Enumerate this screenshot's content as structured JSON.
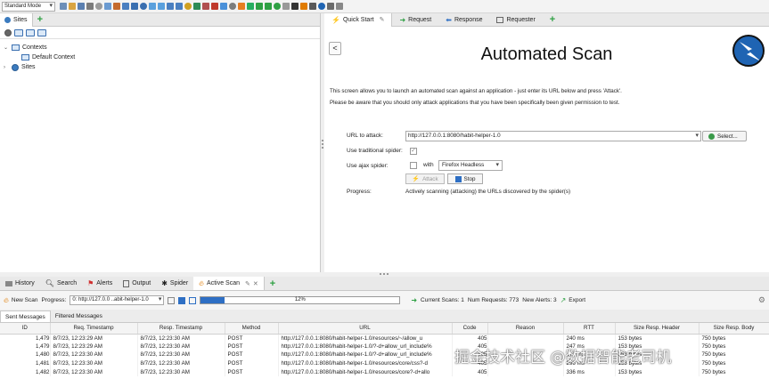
{
  "toolbar": {
    "mode": "Standard Mode",
    "icons": [
      "new-session-icon",
      "open-session-icon",
      "persist-session-icon",
      "snapshot-icon",
      "properties-icon",
      "options-icon",
      "check-updates-icon",
      "layout-left-icon",
      "layout-full-icon",
      "layout-tabs-icon",
      "show-tabs-icon",
      "hide-tabs-icon",
      "expand-sites-icon",
      "expand-info-icon",
      "break-icon",
      "scope-icon",
      "tags-icon",
      "marketplace-icon",
      "manage-add-ons-icon",
      "scripts-icon",
      "bug-icon",
      "hud-icon",
      "breakpoint-icon",
      "step-icon",
      "continue-icon",
      "drop-icon",
      "console-icon",
      "attack-mode-icon",
      "spider-icon",
      "ajax-spider-icon",
      "encode-icon",
      "fuzz-icon"
    ]
  },
  "left_panel": {
    "tab_label": "Sites",
    "tree": {
      "contexts_label": "Contexts",
      "default_context_label": "Default Context",
      "sites_label": "Sites"
    }
  },
  "right_panel": {
    "tabs": [
      "Quick Start",
      "Request",
      "Response",
      "Requester"
    ],
    "title": "Automated Scan",
    "intro_line1": "This screen allows you to launch an automated scan against  an application - just enter its URL below and press 'Attack'.",
    "intro_line2": "Please be aware that you should only attack applications that you have been specifically been given permission to test.",
    "url_label": "URL to attack:",
    "url_value": "http://127.0.0.1:8080/habit-helper-1.0",
    "select_label": "Select...",
    "traditional_spider_label": "Use traditional spider:",
    "ajax_spider_label": "Use ajax spider:",
    "with_label": "with",
    "browser_value": "Firefox Headless",
    "attack_label": "Attack",
    "stop_label": "Stop",
    "progress_label": "Progress:",
    "progress_value": "Actively scanning (attacking) the URLs discovered by the spider(s)"
  },
  "bottom_panel": {
    "tabs": [
      "History",
      "Search",
      "Alerts",
      "Output",
      "Spider",
      "Active Scan"
    ],
    "new_scan_label": "New Scan",
    "progress_label": "Progress:",
    "progress_select_value": "0: http://127.0.0 ..abit-helper-1.0",
    "scan_percent": 12,
    "scan_percent_text": "12%",
    "current_scans": "Current Scans: 1",
    "num_requests": "Num Requests: 773",
    "new_alerts": "New Alerts: 3",
    "export_label": "Export",
    "message_tabs": [
      "Sent Messages",
      "Filtered Messages"
    ],
    "columns": [
      "ID",
      "Req. Timestamp",
      "Resp. Timestamp",
      "Method",
      "URL",
      "Code",
      "Reason",
      "RTT",
      "Size Resp. Header",
      "Size Resp. Body"
    ],
    "rows": [
      [
        "1,479",
        "8/7/23, 12:23:29 AM",
        "8/7/23, 12:23:30 AM",
        "POST",
        "http://127.0.0.1:8080/habit-helper-1.0/resources/~/allow_u",
        "405",
        "",
        "240 ms",
        "153 bytes",
        "750 bytes"
      ],
      [
        "1,479",
        "8/7/23, 12:23:29 AM",
        "8/7/23, 12:23:30 AM",
        "POST",
        "http://127.0.0.1:8080/habit-helper-1.0/?-d+allow_url_include%",
        "405",
        "",
        "247 ms",
        "153 bytes",
        "750 bytes"
      ],
      [
        "1,480",
        "8/7/23, 12:23:30 AM",
        "8/7/23, 12:23:30 AM",
        "POST",
        "http://127.0.0.1:8080/habit-helper-1.0/?-d+allow_url_include%",
        "405",
        "",
        "271 ms",
        "153 bytes",
        "750 bytes"
      ],
      [
        "1,481",
        "8/7/23, 12:23:30 AM",
        "8/7/23, 12:23:30 AM",
        "POST",
        "http://127.0.0.1:8080/habit-helper-1.0/resources/core/css?-d",
        "405",
        "",
        "296 ms",
        "153 bytes",
        "750 bytes"
      ],
      [
        "1,482",
        "8/7/23, 12:23:30 AM",
        "8/7/23, 12:23:30 AM",
        "POST",
        "http://127.0.0.1:8080/habit-helper-1.0/resources/core?-d+allo",
        "405",
        "",
        "336 ms",
        "153 bytes",
        "750 bytes"
      ]
    ]
  },
  "watermark": "掘金技术社区 @数据智能老司机",
  "colors": {
    "accent_blue": "#2e6fc4",
    "green_plus": "#2ea043",
    "logo_blue": "#1f64b3"
  }
}
